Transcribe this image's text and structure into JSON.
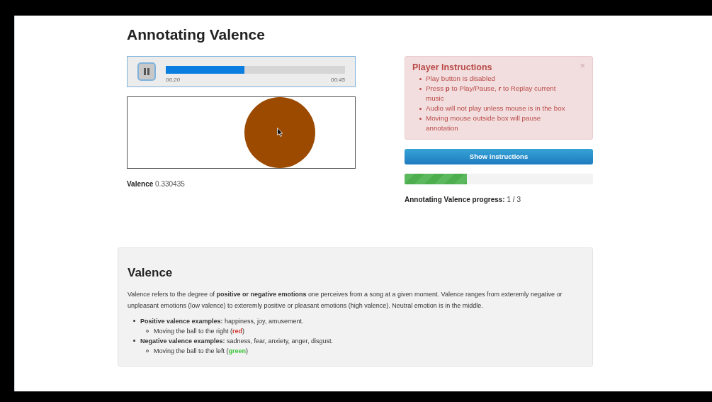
{
  "title": "Annotating Valence",
  "player": {
    "playing": true,
    "level": 0.44,
    "elapsed": "00:20",
    "duration": "00:45"
  },
  "canvas": {
    "level": 0.67
  },
  "valence_readout": {
    "label": "Valence",
    "value": "0.330435"
  },
  "instructions": {
    "title": "Player Instructions",
    "close": "×",
    "items": [
      {
        "parts": [
          "Play button is disabled"
        ]
      },
      {
        "parts": [
          "Press **p** to Play/Pause, **r** to Replay current music"
        ]
      },
      {
        "parts": [
          "Audio will not play unless mouse is in the box"
        ]
      },
      {
        "parts": [
          "Moving mouse outside box will pause annotation"
        ]
      }
    ]
  },
  "show_button": "Show instructions",
  "progress": {
    "level": 0.33,
    "label": "Annotating Valence progress:",
    "value": "1 / 3"
  },
  "info": {
    "heading": "Valence",
    "paragraph": "Valence refers to the degree of **positive or negative emotions** one perceives from a song at a given moment. Valence ranges from exteremly negative or unpleasant emotions (low valence) to exteremly positive or pleasant emotions (high valence). Neutral emotion is in the middle.",
    "examples": [
      {
        "text": "**Positive valence examples:** happiness, joy, amusement.",
        "sub": {
          "prefix": "Moving the ball to the right (",
          "word": "red",
          "color": "#d0342c",
          "suffix": ")"
        }
      },
      {
        "text": "**Negative valence examples:** sadness, fear, anxiety, anger, disgust.",
        "sub": {
          "prefix": "Moving the ball to the left (",
          "word": "green",
          "color": "#3cc43c",
          "suffix": ")"
        }
      }
    ]
  }
}
